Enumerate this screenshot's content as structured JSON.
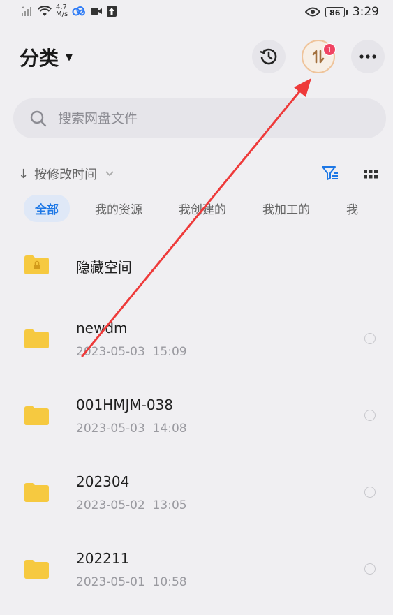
{
  "status_bar": {
    "net_speed_value": "4.7",
    "net_speed_unit": "M/s",
    "battery": "86",
    "time": "3:29"
  },
  "header": {
    "title": "分类",
    "transfer_badge": "1"
  },
  "search": {
    "placeholder": "搜索网盘文件"
  },
  "sort": {
    "label": "按修改时间"
  },
  "tabs": [
    {
      "label": "全部",
      "active": true
    },
    {
      "label": "我的资源"
    },
    {
      "label": "我创建的"
    },
    {
      "label": "我加工的"
    },
    {
      "label": "我"
    }
  ],
  "files": [
    {
      "name": "隐藏空间",
      "locked": true
    },
    {
      "name": "newdm",
      "date": "2023-05-03",
      "time": "15:09"
    },
    {
      "name": "001HMJM-038",
      "date": "2023-05-03",
      "time": "14:08"
    },
    {
      "name": "202304",
      "date": "2023-05-02",
      "time": "13:05"
    },
    {
      "name": "202211",
      "date": "2023-05-01",
      "time": "10:58"
    }
  ],
  "colors": {
    "accent": "#1e78e6",
    "folder": "#f6c940",
    "badge": "#f04463",
    "annotation_arrow": "#ee3a3a"
  }
}
